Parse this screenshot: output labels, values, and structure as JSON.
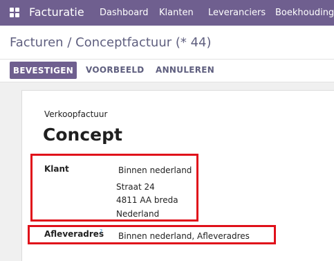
{
  "topbar": {
    "app_name": "Facturatie",
    "menu": [
      "Dashboard",
      "Klanten",
      "Leveranciers",
      "Boekhouding"
    ]
  },
  "breadcrumb": {
    "parent": "Facturen",
    "separator": "/",
    "current": "Conceptfactuur (* 44)"
  },
  "actions": {
    "confirm": "BEVESTIGEN",
    "preview": "VOORBEELD",
    "cancel": "ANNULEREN"
  },
  "document": {
    "type": "Verkoopfactuur",
    "status": "Concept",
    "customer_label": "Klant",
    "customer": {
      "name": "Binnen nederland",
      "street": "Straat 24",
      "city": "4811 AA breda",
      "country": "Nederland"
    },
    "delivery_label": "Afleveradres",
    "delivery_help": "?",
    "delivery_value": "Binnen nederland, Afleveradres"
  },
  "colors": {
    "brand": "#6f5f8f",
    "highlight": "#e0101a"
  }
}
